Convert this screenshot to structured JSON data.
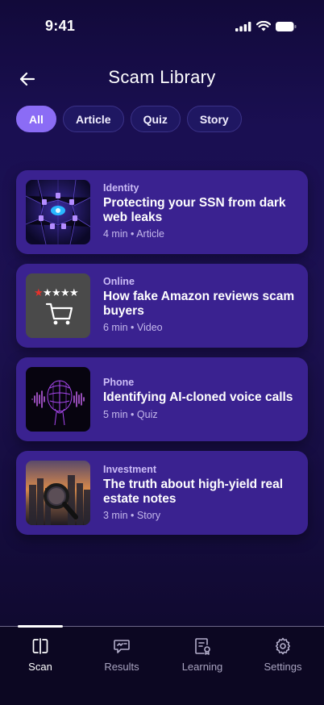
{
  "status_bar": {
    "time": "9:41"
  },
  "header": {
    "title": "Scam Library"
  },
  "filters": [
    {
      "label": "All",
      "active": true
    },
    {
      "label": "Article",
      "active": false
    },
    {
      "label": "Quiz",
      "active": false
    },
    {
      "label": "Story",
      "active": false
    }
  ],
  "items": [
    {
      "category": "Identity",
      "title": "Protecting your SSN from dark web leaks",
      "meta": "4 min • Article",
      "thumb": "network-lock-icon"
    },
    {
      "category": "Online",
      "title": "How fake Amazon reviews scam buyers",
      "meta": "6 min • Video",
      "thumb": "star-rating-cart-icon"
    },
    {
      "category": "Phone",
      "title": "Identifying AI-cloned voice calls",
      "meta": "5 min • Quiz",
      "thumb": "ai-voice-head-icon"
    },
    {
      "category": "Investment",
      "title": "The truth about high-yield real estate notes",
      "meta": "3 min • Story",
      "thumb": "magnifier-city-icon"
    }
  ],
  "tabbar": {
    "tabs": [
      {
        "label": "Scan",
        "active": true
      },
      {
        "label": "Results",
        "active": false
      },
      {
        "label": "Learning",
        "active": false
      },
      {
        "label": "Settings",
        "active": false
      }
    ]
  },
  "colors": {
    "accent": "#8b6cf5",
    "card": "#3a2290",
    "background": "#1a0f52"
  }
}
